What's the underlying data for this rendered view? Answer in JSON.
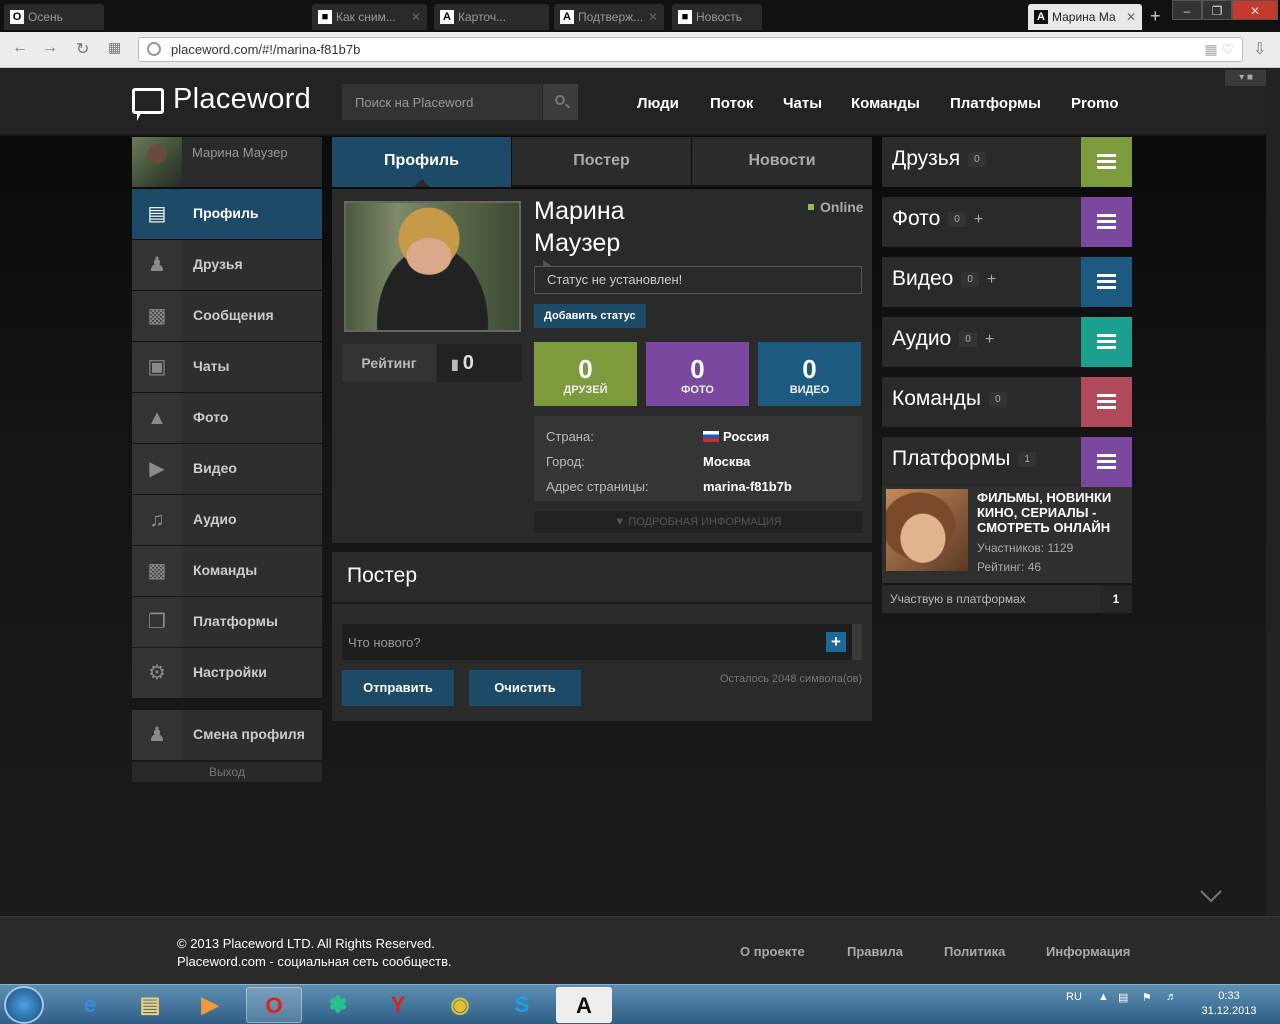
{
  "browser": {
    "tabs": [
      {
        "label": "Осень",
        "icon": "opera-icon",
        "active": false
      },
      {
        "label": "Как сним...",
        "icon": "page-icon",
        "active": false
      },
      {
        "label": "Карточ...",
        "icon": "a-icon",
        "active": false
      },
      {
        "label": "Подтверж...",
        "icon": "a-icon",
        "active": false
      },
      {
        "label": "Новость",
        "icon": "page-icon",
        "active": false
      },
      {
        "label": "Марина Ма",
        "icon": "a-icon",
        "active": true
      }
    ],
    "url": "placeword.com/#!/marina-f81b7b",
    "accent": "#c43a2c"
  },
  "header": {
    "logo": "Placeword",
    "search_placeholder": "Поиск на Placeword",
    "nav": [
      "Люди",
      "Поток",
      "Чаты",
      "Команды",
      "Платформы",
      "Promo"
    ]
  },
  "sidebar": {
    "user_name": "Марина Маузер",
    "items": [
      {
        "label": "Профиль",
        "icon": "profile-card-icon",
        "active": true
      },
      {
        "label": "Друзья",
        "icon": "friends-icon"
      },
      {
        "label": "Сообщения",
        "icon": "message-icon"
      },
      {
        "label": "Чаты",
        "icon": "chats-icon"
      },
      {
        "label": "Фото",
        "icon": "photo-icon"
      },
      {
        "label": "Видео",
        "icon": "video-icon"
      },
      {
        "label": "Аудио",
        "icon": "audio-icon"
      },
      {
        "label": "Команды",
        "icon": "teams-icon"
      },
      {
        "label": "Платформы",
        "icon": "platforms-icon"
      },
      {
        "label": "Настройки",
        "icon": "gear-icon"
      }
    ],
    "switch_profile": "Смена профиля",
    "logout": "Выход",
    "active_color": "#1d4a66"
  },
  "profile": {
    "tabs": [
      "Профиль",
      "Постер",
      "Новости"
    ],
    "first_name": "Марина",
    "last_name": "Маузер",
    "online": "Online",
    "status": "Статус не установлен!",
    "add_status": "Добавить статус",
    "rating_label": "Рейтинг",
    "rating_value": "0",
    "stats": [
      {
        "value": "0",
        "label": "ДРУЗЕЙ",
        "color": "#7d9a3c"
      },
      {
        "value": "0",
        "label": "ФОТО",
        "color": "#7b48a0"
      },
      {
        "value": "0",
        "label": "ВИДЕО",
        "color": "#1d5a80"
      }
    ],
    "info": {
      "country_label": "Страна:",
      "country": "Россия",
      "city_label": "Город:",
      "city": "Москва",
      "address_label": "Адрес страницы:",
      "address": "marina-f81b7b"
    },
    "more_info": "ПОДРОБНАЯ ИНФОРМАЦИЯ"
  },
  "poster": {
    "title": "Постер",
    "placeholder": "Что нового?",
    "send": "Отправить",
    "clear": "Очистить",
    "remaining": "Осталось 2048 символа(ов)"
  },
  "widgets": [
    {
      "title": "Друзья",
      "count": "0",
      "plus": false,
      "color": "#7d9a3c"
    },
    {
      "title": "Фото",
      "count": "0",
      "plus": true,
      "color": "#7b48a0"
    },
    {
      "title": "Видео",
      "count": "0",
      "plus": true,
      "color": "#1d5a80"
    },
    {
      "title": "Аудио",
      "count": "0",
      "plus": true,
      "color": "#1aa08c"
    },
    {
      "title": "Команды",
      "count": "0",
      "plus": false,
      "color": "#b04a5a"
    },
    {
      "title": "Платформы",
      "count": "1",
      "plus": false,
      "color": "#7b48a0"
    }
  ],
  "platform": {
    "name": "ФИЛЬМЫ, НОВИНКИ КИНО, СЕРИАЛЫ - СМОТРЕТЬ ОНЛАЙН",
    "members": "Участников: 1129",
    "rating": "Рейтинг: 46",
    "footer_label": "Участвую в платформах",
    "footer_count": "1"
  },
  "footer": {
    "copyright": "© 2013 Placeword LTD. All Rights Reserved.",
    "tagline": "Placeword.com - социальная сеть сообществ.",
    "links": [
      "О проекте",
      "Правила",
      "Политика",
      "Информация"
    ]
  },
  "taskbar": {
    "lang": "RU",
    "time": "0:33",
    "date": "31.12.2013"
  }
}
